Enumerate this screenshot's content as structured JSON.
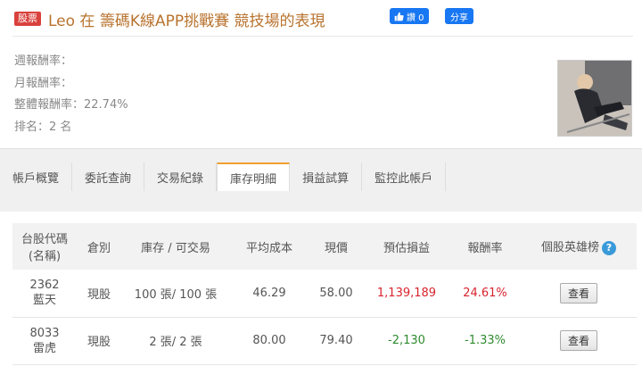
{
  "header": {
    "badge": "股票",
    "title": "Leo 在 籌碼K線APP挑戰賽 競技場的表現",
    "like_label": "讚 0",
    "share_label": "分享"
  },
  "stats": {
    "weekly": "週報酬率：",
    "monthly": "月報酬率：",
    "overall": "整體報酬率：22.74%",
    "rank": "排名：2 名"
  },
  "tabs": [
    {
      "label": "帳戶概覽"
    },
    {
      "label": "委託查詢"
    },
    {
      "label": "交易紀錄"
    },
    {
      "label": "庫存明細",
      "active": true
    },
    {
      "label": "損益試算"
    },
    {
      "label": "監控此帳戶"
    }
  ],
  "table": {
    "headers": {
      "code_line1": "台股代碼",
      "code_line2": "(名稱)",
      "type": "倉別",
      "holding": "庫存 / 可交易",
      "avg_cost": "平均成本",
      "price": "現價",
      "pnl": "預估損益",
      "return": "報酬率",
      "hero": "個股英雄榜"
    },
    "rows": [
      {
        "code": "2362",
        "name": "藍天",
        "type": "現股",
        "holding": "100 張/ 100 張",
        "avg_cost": "46.29",
        "price": "58.00",
        "pnl": "1,139,189",
        "return": "24.61%",
        "action": "查看"
      },
      {
        "code": "8033",
        "name": "雷虎",
        "type": "現股",
        "holding": "2 張/ 2 張",
        "avg_cost": "80.00",
        "price": "79.40",
        "pnl": "-2,130",
        "return": "-1.33%",
        "action": "查看"
      }
    ],
    "help_icon": "?"
  },
  "colors": {
    "badge": "#d9413c",
    "title": "#b8732e",
    "facebook": "#1877f2",
    "tab_accent": "#f0a030",
    "positive": "#d9232e",
    "negative": "#2e8b2e"
  }
}
